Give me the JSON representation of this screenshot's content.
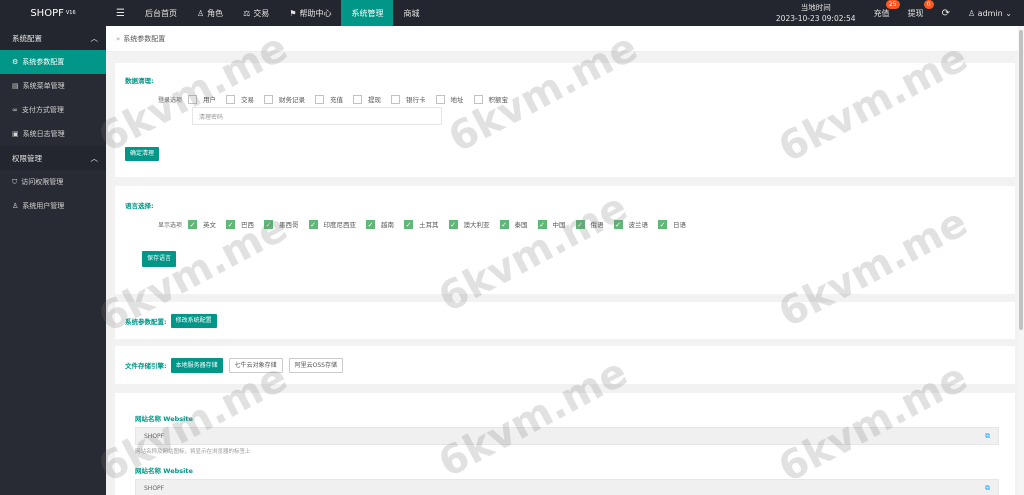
{
  "topbar": {
    "logo": "SHOPF",
    "logo_version": "V16",
    "menu_icon": "menu-icon",
    "nav": [
      {
        "label": "后台首页",
        "icon": ""
      },
      {
        "label": "角色",
        "icon": "user-icon"
      },
      {
        "label": "交易",
        "icon": "scale-icon"
      },
      {
        "label": "帮助中心",
        "icon": "flag-icon"
      },
      {
        "label": "系统管理",
        "icon": ""
      },
      {
        "label": "商城",
        "icon": ""
      }
    ],
    "clock_label": "当地时间",
    "clock_value": "2023-10-23 09:02:54",
    "recharge_label": "充值",
    "recharge_badge": "25",
    "withdraw_label": "提现",
    "withdraw_badge": "0",
    "username": "admin",
    "active_color": "#009688"
  },
  "sidebar": {
    "groups": [
      {
        "label": "系统配置",
        "items": [
          {
            "label": "系统参数配置",
            "icon": "gear-icon"
          },
          {
            "label": "系统菜单管理",
            "icon": "menu-grid-icon"
          },
          {
            "label": "支付方式管理",
            "icon": "link-icon"
          },
          {
            "label": "系统日志管理",
            "icon": "log-icon"
          }
        ]
      },
      {
        "label": "权限管理",
        "items": [
          {
            "label": "访问权限管理",
            "icon": "shield-icon"
          },
          {
            "label": "系统用户管理",
            "icon": "user-icon"
          }
        ]
      }
    ]
  },
  "breadcrumb": {
    "label": "系统参数配置"
  },
  "data_clean": {
    "title": "数据清理:",
    "label": "登录选项",
    "options": [
      "用户",
      "交易",
      "财务记录",
      "充值",
      "提现",
      "银行卡",
      "地址",
      "积额宝"
    ],
    "password_placeholder": "清理密码",
    "button": "确定清理"
  },
  "language": {
    "title": "语言选择:",
    "label": "显示选项",
    "options": [
      "英文",
      "巴西",
      "墨西哥",
      "印度尼西亚",
      "越南",
      "土耳其",
      "澳大利亚",
      "泰国",
      "中国",
      "俄语",
      "波兰语",
      "日语"
    ],
    "button": "保存语言"
  },
  "sys_params": {
    "title": "系统参数配置:",
    "button": "修改系统配置"
  },
  "storage": {
    "title": "文件存储引擎:",
    "buttons": [
      "本地服务器存储",
      "七牛云对象存储",
      "阿里云OSS存储"
    ]
  },
  "site": {
    "field1_label": "网站名称 Website",
    "field1_value": "SHOPF",
    "field1_hint": "网站名称及网站图标，将显示在浏览器的标签上",
    "field2_label": "网站名称 Website",
    "field2_value": "SHOPF"
  },
  "watermark": "6kvm.me"
}
